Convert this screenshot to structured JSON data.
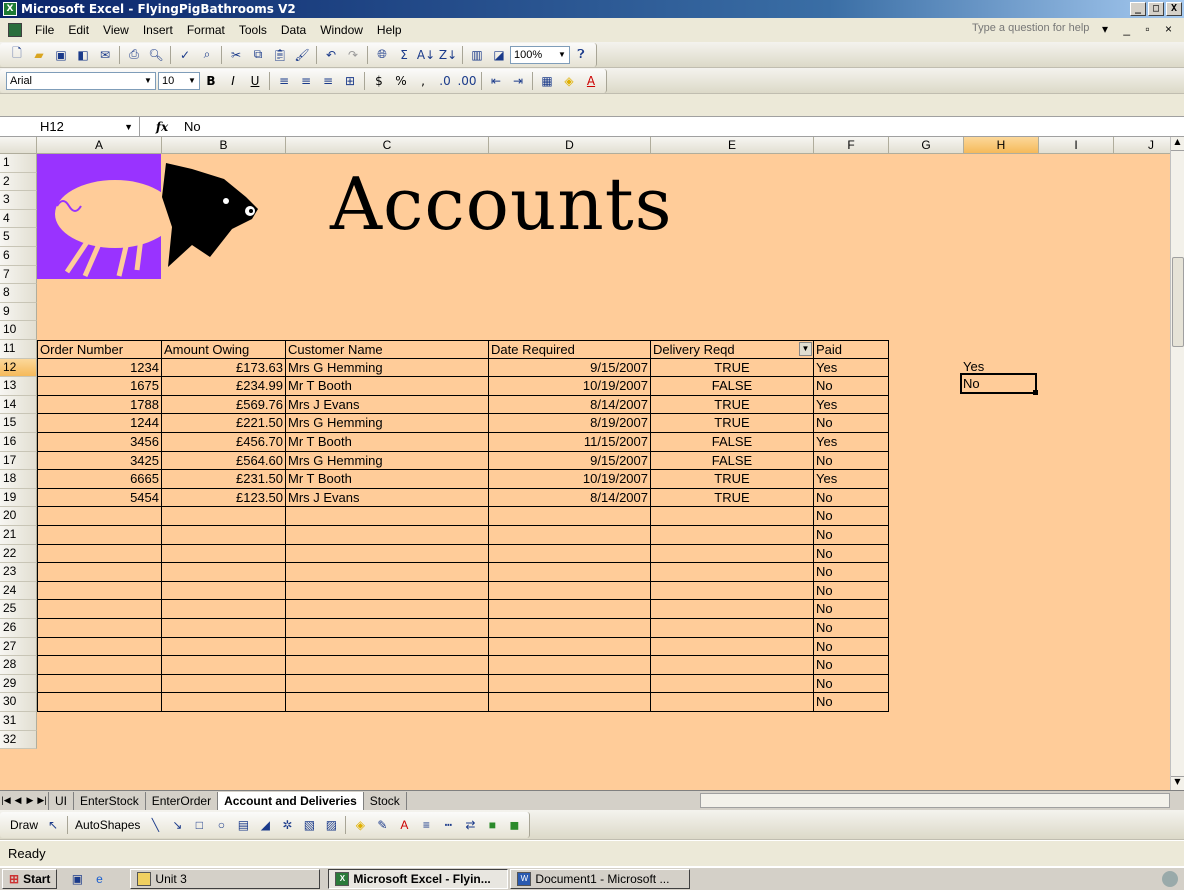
{
  "window": {
    "title": "Microsoft Excel - FlyingPigBathrooms V2",
    "buttons": [
      "_",
      "□",
      "X"
    ]
  },
  "menu": {
    "items": [
      "File",
      "Edit",
      "View",
      "Insert",
      "Format",
      "Tools",
      "Data",
      "Window",
      "Help"
    ],
    "help_placeholder": "Type a question for help"
  },
  "standard_toolbar": {
    "zoom": "100%"
  },
  "formatting_toolbar": {
    "font": "Arial",
    "size": "10",
    "bold": "B",
    "italic": "I",
    "underline": "U",
    "currency": "$",
    "percent": "%",
    "comma": ","
  },
  "formula_bar": {
    "name_box": "H12",
    "fx": "fx",
    "content": "No"
  },
  "columns": [
    "A",
    "B",
    "C",
    "D",
    "E",
    "F",
    "G",
    "H",
    "I",
    "J"
  ],
  "rows": [
    "1",
    "2",
    "3",
    "4",
    "5",
    "6",
    "7",
    "8",
    "9",
    "10",
    "11",
    "12",
    "13",
    "14",
    "15",
    "16",
    "17",
    "18",
    "19",
    "20",
    "21",
    "22",
    "23",
    "24",
    "25",
    "26",
    "27",
    "28",
    "29",
    "30",
    "31",
    "32"
  ],
  "banner": {
    "title": "Accounts"
  },
  "table": {
    "headers": [
      "Order Number",
      "Amount Owing",
      "Customer Name",
      "Date Required",
      "Delivery Reqd",
      "Paid"
    ],
    "rows": [
      [
        "1234",
        "£173.63",
        "Mrs G Hemming",
        "9/15/2007",
        "TRUE",
        "Yes"
      ],
      [
        "1675",
        "£234.99",
        "Mr T Booth",
        "10/19/2007",
        "FALSE",
        "No"
      ],
      [
        "1788",
        "£569.76",
        "Mrs J Evans",
        "8/14/2007",
        "TRUE",
        "Yes"
      ],
      [
        "1244",
        "£221.50",
        "Mrs G Hemming",
        "8/19/2007",
        "TRUE",
        "No"
      ],
      [
        "3456",
        "£456.70",
        "Mr T Booth",
        "11/15/2007",
        "FALSE",
        "Yes"
      ],
      [
        "3425",
        "£564.60",
        "Mrs G Hemming",
        "9/15/2007",
        "FALSE",
        "No"
      ],
      [
        "6665",
        "£231.50",
        "Mr T Booth",
        "10/19/2007",
        "TRUE",
        "Yes"
      ],
      [
        "5454",
        "£123.50",
        "Mrs J Evans",
        "8/14/2007",
        "TRUE",
        "No"
      ],
      [
        "",
        "",
        "",
        "",
        "",
        "No"
      ],
      [
        "",
        "",
        "",
        "",
        "",
        "No"
      ],
      [
        "",
        "",
        "",
        "",
        "",
        "No"
      ],
      [
        "",
        "",
        "",
        "",
        "",
        "No"
      ],
      [
        "",
        "",
        "",
        "",
        "",
        "No"
      ],
      [
        "",
        "",
        "",
        "",
        "",
        "No"
      ],
      [
        "",
        "",
        "",
        "",
        "",
        "No"
      ],
      [
        "",
        "",
        "",
        "",
        "",
        "No"
      ],
      [
        "",
        "",
        "",
        "",
        "",
        "No"
      ],
      [
        "",
        "",
        "",
        "",
        "",
        "No"
      ],
      [
        "",
        "",
        "",
        "",
        "",
        "No"
      ]
    ]
  },
  "side_list": {
    "h11": "Yes",
    "h12": "No"
  },
  "sheet_tabs": [
    "UI",
    "EnterStock",
    "EnterOrder",
    "Account and Deliveries",
    "Stock"
  ],
  "active_tab": "Account and Deliveries",
  "drawing_toolbar": {
    "draw": "Draw",
    "autoshapes": "AutoShapes"
  },
  "status": {
    "text": "Ready"
  },
  "taskbar": {
    "start": "Start",
    "items": [
      "Unit 3",
      "Microsoft Excel - Flyin...",
      "Document1 - Microsoft ..."
    ]
  },
  "colors": {
    "sheet_bg": "#ffcc99",
    "logo_bg": "#9933ff",
    "title_bar": "#0a246a"
  }
}
